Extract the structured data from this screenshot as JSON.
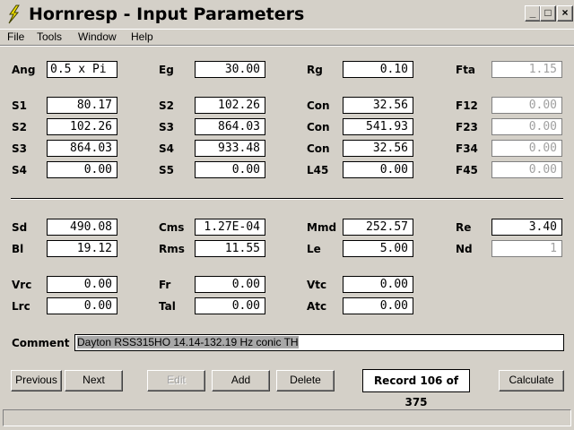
{
  "window": {
    "title": "Hornresp - Input Parameters",
    "min_glyph": "_",
    "max_glyph": "□",
    "close_glyph": "×"
  },
  "menu": [
    "File",
    "Tools",
    "Window",
    "Help"
  ],
  "fields": {
    "Ang": "0.5 x Pi",
    "Eg": "30.00",
    "Rg": "0.10",
    "Fta": "1.15",
    "S1": "80.17",
    "S2_r1": "102.26",
    "Con_r1": "32.56",
    "F12": "0.00",
    "S2_r2": "102.26",
    "S3_r2": "864.03",
    "Con_r2": "541.93",
    "F23": "0.00",
    "S3_r3": "864.03",
    "S4_r3": "933.48",
    "Con_r3": "32.56",
    "F34": "0.00",
    "S4_r4": "0.00",
    "S5": "0.00",
    "L45": "0.00",
    "F45": "0.00",
    "Sd": "490.08",
    "Cms": "1.27E-04",
    "Mmd": "252.57",
    "Re": "3.40",
    "Bl": "19.12",
    "Rms": "11.55",
    "Le": "5.00",
    "Nd": "1",
    "Vrc": "0.00",
    "Fr": "0.00",
    "Vtc": "0.00",
    "Lrc": "0.00",
    "Tal": "0.00",
    "Atc": "0.00"
  },
  "labels": {
    "Ang": "Ang",
    "Eg": "Eg",
    "Rg": "Rg",
    "Fta": "Fta",
    "S1": "S1",
    "S2": "S2",
    "Con": "Con",
    "F12": "F12",
    "S3": "S3",
    "F23": "F23",
    "S4": "S4",
    "F34": "F34",
    "S5": "S5",
    "L45": "L45",
    "F45": "F45",
    "Sd": "Sd",
    "Cms": "Cms",
    "Mmd": "Mmd",
    "Re": "Re",
    "Bl": "Bl",
    "Rms": "Rms",
    "Le": "Le",
    "Nd": "Nd",
    "Vrc": "Vrc",
    "Fr": "Fr",
    "Vtc": "Vtc",
    "Lrc": "Lrc",
    "Tal": "Tal",
    "Atc": "Atc",
    "Comment": "Comment"
  },
  "comment": "Dayton RSS315HO 14.14-132.19 Hz conic TH",
  "buttons": {
    "previous": "Previous",
    "next": "Next",
    "edit": "Edit",
    "add": "Add",
    "delete": "Delete",
    "calculate": "Calculate"
  },
  "record": "Record 106 of 375",
  "colors": {
    "window_bg": "#d4d0c8",
    "disabled_text": "#a0a0a0",
    "selection": "#a8a8a8"
  }
}
